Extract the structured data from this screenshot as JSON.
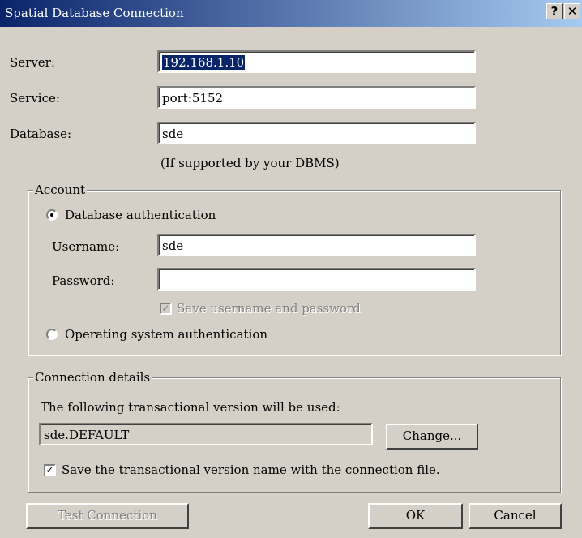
{
  "window": {
    "title": "Spatial Database Connection",
    "help_button": "?",
    "close_button": "✕"
  },
  "server": {
    "label": "Server:",
    "value": "192.168.1.10"
  },
  "service": {
    "label": "Service:",
    "value": "port:5152"
  },
  "database": {
    "label": "Database:",
    "value": "sde",
    "hint": "(If supported by your DBMS)"
  },
  "account": {
    "legend": "Account",
    "db_auth": {
      "label": "Database authentication",
      "selected": true
    },
    "username": {
      "label": "Username:",
      "value": "sde"
    },
    "password": {
      "label": "Password:",
      "value": ""
    },
    "save_credentials": {
      "label": "Save username and password",
      "checked": true,
      "enabled": false
    },
    "os_auth": {
      "label": "Operating system authentication",
      "selected": false
    }
  },
  "connection_details": {
    "legend": "Connection details",
    "description": "The following transactional version will be used:",
    "version": "sde.DEFAULT",
    "change_label": "Change...",
    "save_version": {
      "label": "Save the transactional version name with the connection file.",
      "checked": true
    }
  },
  "buttons": {
    "test_connection": "Test Connection",
    "ok": "OK",
    "cancel": "Cancel"
  }
}
